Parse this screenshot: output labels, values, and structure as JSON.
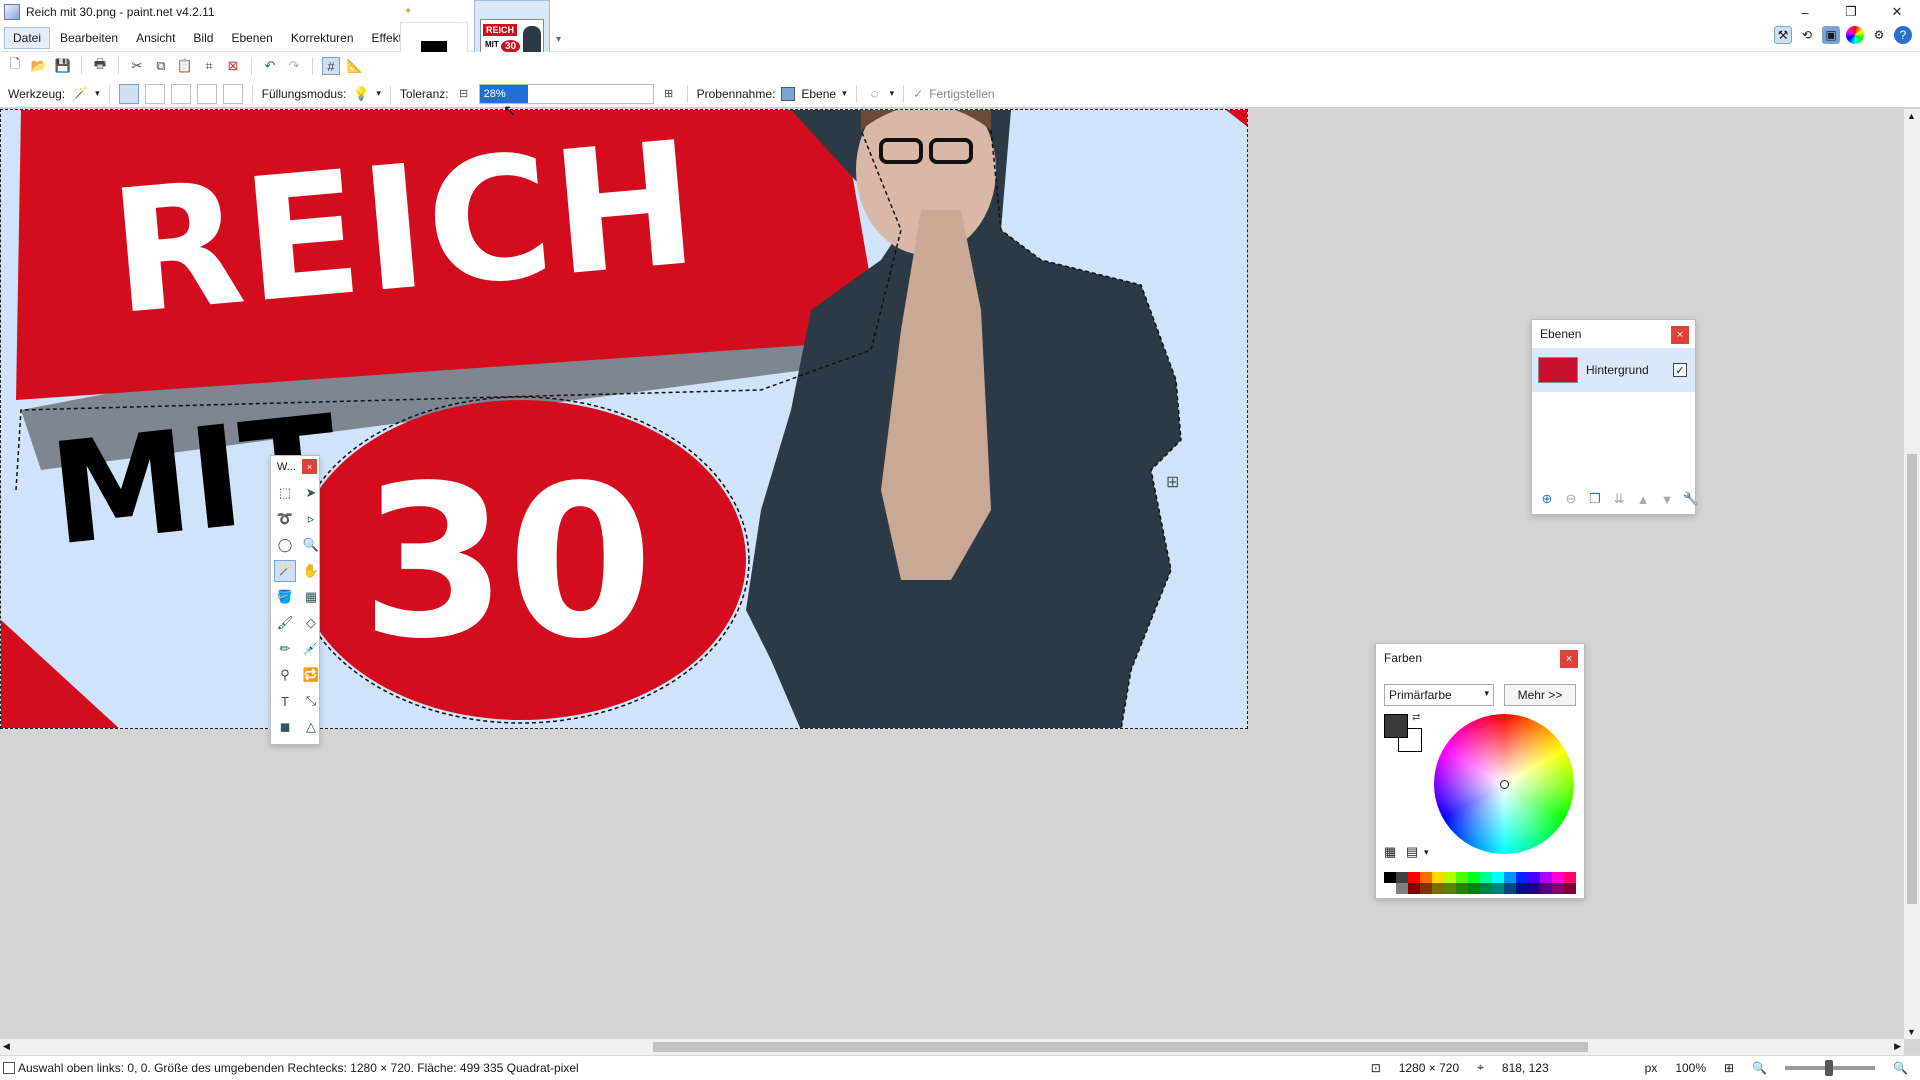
{
  "window": {
    "title": "Reich mit 30.png - paint.net v4.2.11",
    "minimize": "–",
    "restore": "❐",
    "close": "✕"
  },
  "menu": [
    "Datei",
    "Bearbeiten",
    "Ansicht",
    "Bild",
    "Ebenen",
    "Korrekturen",
    "Effekte"
  ],
  "image_thumb": {
    "line1": "REICH",
    "line2": "MIT",
    "line3": "30"
  },
  "tool_options": {
    "tool_label": "Werkzeug:",
    "fill_mode_label": "Füllungsmodus:",
    "tolerance_label": "Toleranz:",
    "tolerance_value": "28%",
    "sampling_label": "Probennahme:",
    "sampling_value": "Ebene",
    "finish_label": "Fertigstellen"
  },
  "canvas_art": {
    "headline": "REICH",
    "subline": "MIT",
    "number": "30"
  },
  "tools_panel": {
    "title": "W..."
  },
  "layers_panel": {
    "title": "Ebenen",
    "layer_name": "Hintergrund"
  },
  "colors_panel": {
    "title": "Farben",
    "primary_select": "Primärfarbe",
    "more_button": "Mehr >>"
  },
  "status": {
    "selection_info": "Auswahl oben links: 0, 0. Größe des umgebenden Rechtecks: 1280 × 720. Fläche: 499 335 Quadrat-pixel",
    "image_size": "1280 × 720",
    "cursor_pos": "818, 123",
    "unit": "px",
    "zoom": "100%"
  },
  "colors": {
    "accent": "#1f6fd6",
    "red": "#d40d1e",
    "canvas_bg": "#cfe3fa",
    "shirt": "#2c3a45"
  }
}
